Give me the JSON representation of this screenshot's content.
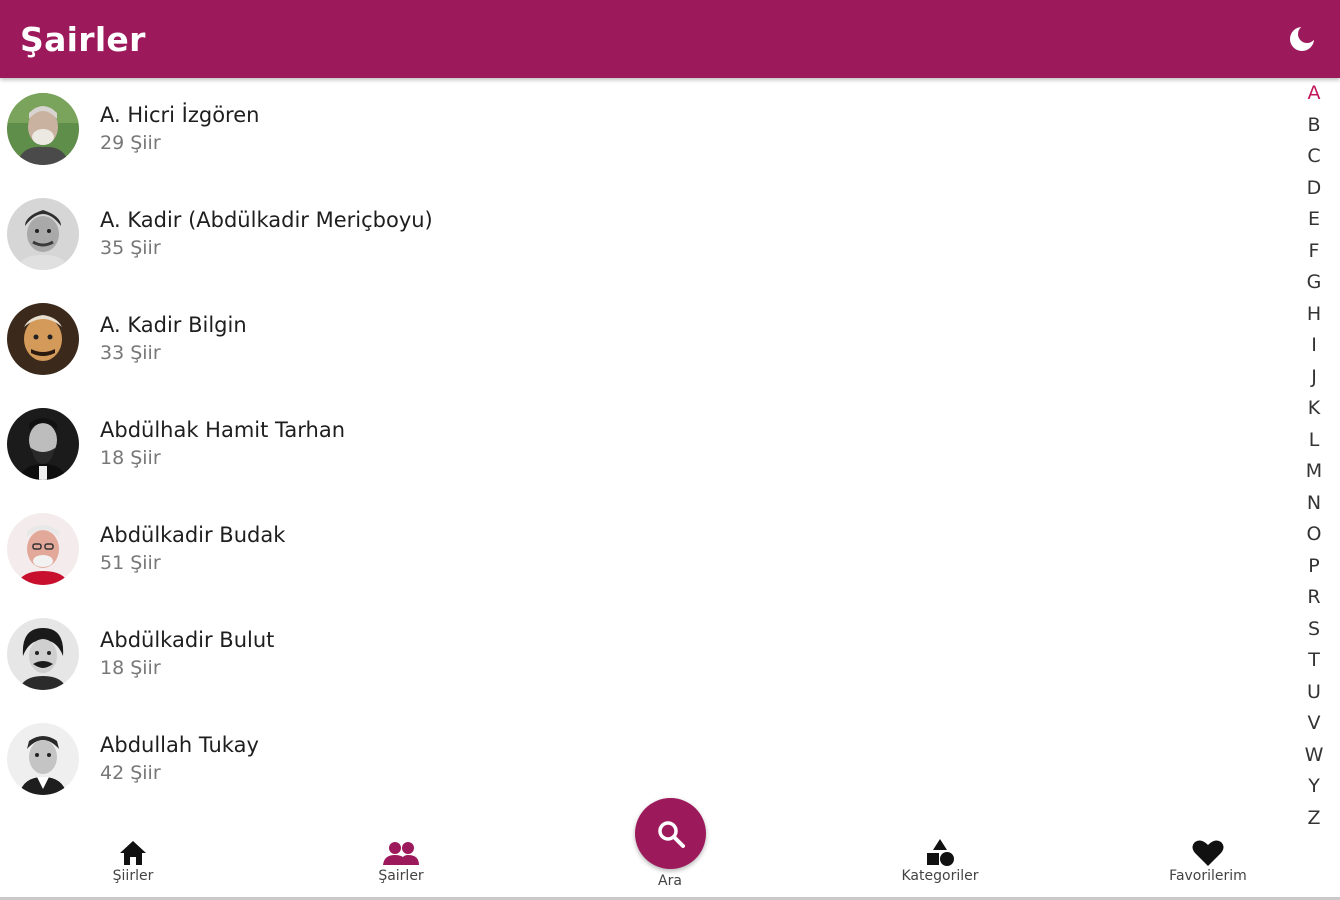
{
  "appbar": {
    "title": "Şairler",
    "theme_icon": "moon-icon"
  },
  "poets": [
    {
      "name": "A. Hicri İzgören",
      "count": "29 Şiir"
    },
    {
      "name": "A. Kadir (Abdülkadir Meriçboyu)",
      "count": "35 Şiir"
    },
    {
      "name": "A. Kadir Bilgin",
      "count": "33 Şiir"
    },
    {
      "name": "Abdülhak Hamit Tarhan",
      "count": "18 Şiir"
    },
    {
      "name": "Abdülkadir Budak",
      "count": "51 Şiir"
    },
    {
      "name": "Abdülkadir Bulut",
      "count": "18 Şiir"
    },
    {
      "name": "Abdullah Tukay",
      "count": "42 Şiir"
    }
  ],
  "alphabet": [
    "A",
    "B",
    "C",
    "D",
    "E",
    "F",
    "G",
    "H",
    "I",
    "J",
    "K",
    "L",
    "M",
    "N",
    "O",
    "P",
    "R",
    "S",
    "T",
    "U",
    "V",
    "W",
    "Y",
    "Z"
  ],
  "alphabet_active": "A",
  "bottom_nav": {
    "home": {
      "label": "Şiirler",
      "icon": "home-icon"
    },
    "poets": {
      "label": "Şairler",
      "icon": "people-icon"
    },
    "search": {
      "label": "Ara",
      "icon": "search-icon"
    },
    "categories": {
      "label": "Kategoriler",
      "icon": "shapes-icon"
    },
    "favorites": {
      "label": "Favorilerim",
      "icon": "heart-icon"
    }
  },
  "colors": {
    "primary": "#9c195c",
    "active_letter": "#c2185b"
  }
}
